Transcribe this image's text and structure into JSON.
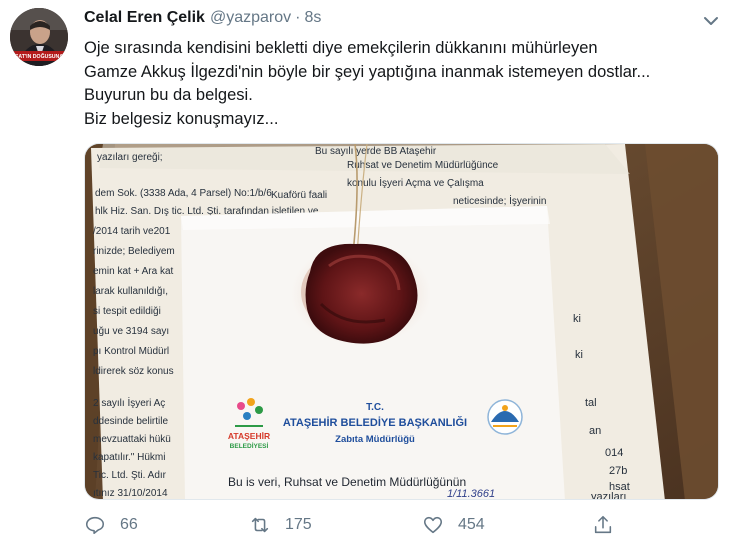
{
  "tweet": {
    "author_name": "Celal Eren Çelik",
    "handle": "@yazparov",
    "separator": "·",
    "timestamp": "8s",
    "lines": [
      "Oje sırasında kendisini bekletti diye emekçilerin dükkanını mühürleyen",
      "Gamze Akkuş İlgezdi'nin böyle bir şeyi yaptığına inanmak istemeyen dostlar...",
      "Buyurun bu da belgesi.",
      "Biz belgesiz konuşmayız..."
    ]
  },
  "avatar": {
    "caption": "SAT'IN DOĞUSUNA"
  },
  "document": {
    "bg_lines": [
      "yazıları gereği;",
      "Bu sayılı yerde BB Ataşehir",
      "dem Sok. (3338 Ada, 4 Parsel) No:1/b/6",
      "Ruhsat ve Denetim Müdürlüğünce",
      "hlk Hiz. San. Dış tic. Ltd. Şti. tarafından işletilen ve",
      "konulu İşyeri Açma ve Çalışma",
      "Kuaförü faali",
      "neticesinde; İşyerinin",
      "/2014 tarih ve201",
      "rinizde; Belediyem",
      "emin kat + Ara kat",
      "larak kullanıldığı,",
      "si tespit edildiği",
      "uğu ve 3194 sayı",
      "pı Kontrol Müdürl",
      "ldirerek söz konus",
      "2 sayılı İşyeri Aç",
      "ddesinde belirtile",
      "mevzuattaki hükü",
      "kapatılır.\" Hükmi",
      "Tic. Ltd. Şti. Adır",
      "ıtınız 31/10/2014"
    ],
    "right_edge": [
      "ki",
      "ki",
      "tal",
      "an",
      "014",
      "27b",
      "hsat",
      "yazıları"
    ],
    "tc": "T.C.",
    "municipality": "ATAŞEHİR BELEDİYE BAŞKANLIĞI",
    "department": "Zabıta Müdürlüğü",
    "logo_line1": "ATAŞEHİR",
    "logo_line2": "BELEDİYESİ",
    "bottom_text": "Bu is veri, Ruhsat ve Denetim Müdürlüğünün",
    "handwriting": "1/11.3661"
  },
  "actions": {
    "replies": "66",
    "retweets": "175",
    "likes": "454"
  },
  "colors": {
    "text": "#14171a",
    "secondary": "#657786",
    "wax_seal": "#6e1a1c",
    "document_title": "#1f4e9c"
  },
  "icons": [
    "chevron-down-icon",
    "reply-icon",
    "retweet-icon",
    "like-icon",
    "share-icon"
  ]
}
